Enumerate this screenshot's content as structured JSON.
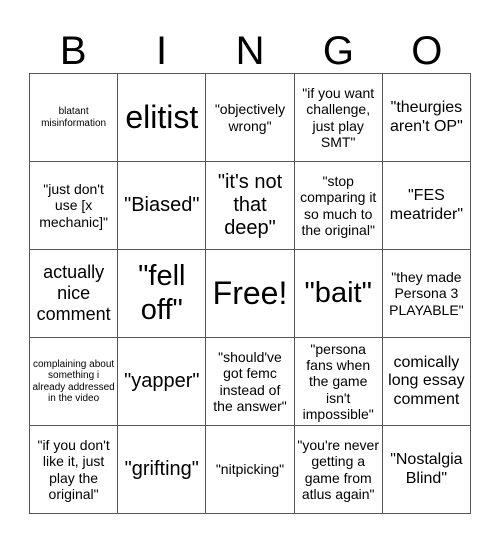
{
  "header": {
    "letters": [
      "B",
      "I",
      "N",
      "G",
      "O"
    ]
  },
  "cells": [
    "blatant misinformation",
    "elitist",
    "\"objectively wrong\"",
    "\"if you want challenge, just play SMT\"",
    "\"theurgies aren't OP\"",
    "\"just don't use [x mechanic]\"",
    "\"Biased\"",
    "\"it's not that deep\"",
    "\"stop comparing it so much to the original\"",
    "\"FES meatrider\"",
    "actually nice comment",
    "\"fell off\"",
    "Free!",
    "\"bait\"",
    "\"they made Persona 3 PLAYABLE\"",
    "complaining about something i already addressed in the video",
    "\"yapper\"",
    "\"should've got femc instead of the answer\"",
    "\"persona fans when the game isn't impossible\"",
    "comically long essay comment",
    "\"if you don't like it, just play the original\"",
    "\"grifting\"",
    "\"nitpicking\"",
    "\"you're never getting a game from atlus again\"",
    "\"Nostalgia Blind\""
  ]
}
